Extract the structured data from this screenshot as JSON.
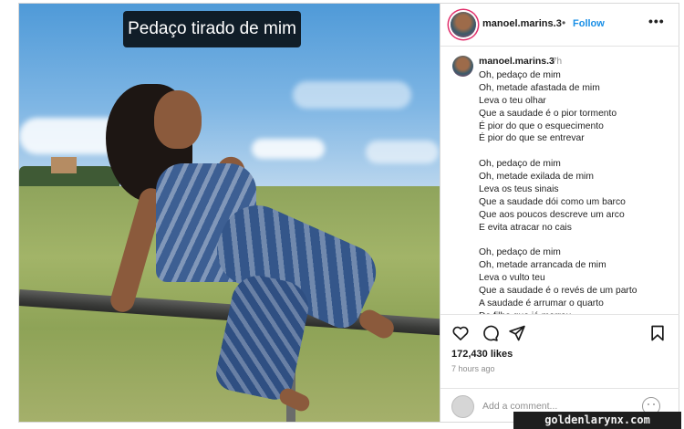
{
  "photo": {
    "caption": "Pedaço tirado de mim"
  },
  "header": {
    "username": "manoel.marins.3",
    "separator": "•",
    "follow_label": "Follow",
    "more_icon": "more-horizontal-icon"
  },
  "comment": {
    "username": "manoel.marins.3",
    "time": "7h",
    "lines": [
      "Oh, pedaço de mim",
      "Oh, metade afastada de mim",
      "Leva o teu olhar",
      "Que a saudade é o pior tormento",
      "É pior do que o esquecimento",
      "É pior do que se entrevar",
      "",
      "Oh, pedaço de mim",
      "Oh, metade exilada de mim",
      "Leva os teus sinais",
      "Que a saudade dói como um barco",
      "Que aos poucos descreve um arco",
      "E evita atracar no cais",
      "",
      "Oh, pedaço de mim",
      "Oh, metade arrancada de mim",
      "Leva o vulto teu",
      "Que a saudade é o revés de um parto",
      "A saudade é arrumar o quarto",
      "Do filho que já morreu"
    ]
  },
  "actions": {
    "icons": [
      "heart-icon",
      "comment-icon",
      "share-icon",
      "bookmark-icon"
    ],
    "likes": "172,430 likes",
    "time_ago": "7 hours ago"
  },
  "add_comment": {
    "placeholder": "Add a comment...",
    "emoji_icon": "emoji-icon"
  },
  "watermark": "goldenlarynx.com",
  "colors": {
    "follow": "#1a8fe6",
    "story_ring": "#e1306c",
    "caption_bg": "#000000"
  }
}
